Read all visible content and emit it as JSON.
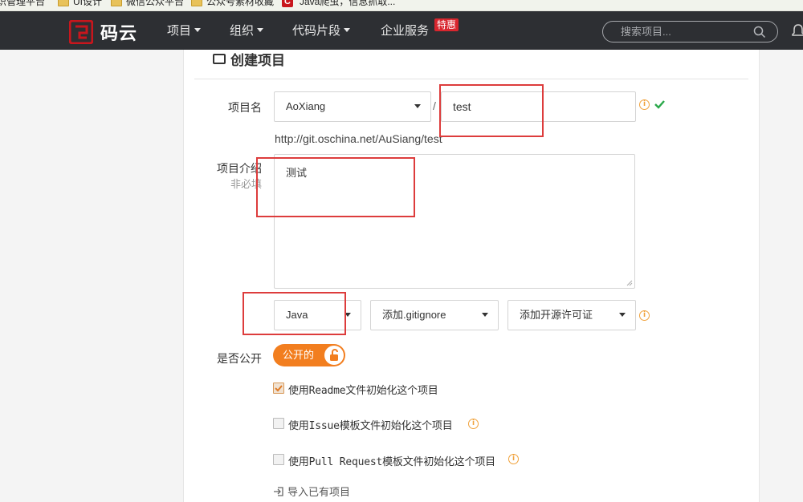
{
  "bookmarks": [
    {
      "label": "识管理平台",
      "type": "text"
    },
    {
      "label": "UI设计",
      "type": "folder"
    },
    {
      "label": "微信公众平台",
      "type": "folder"
    },
    {
      "label": "公众号素材收藏",
      "type": "folder"
    },
    {
      "label": "Java爬虫，信息抓取...",
      "type": "csdn"
    }
  ],
  "navbar": {
    "logo_text": "码云",
    "items": [
      {
        "label": "项目"
      },
      {
        "label": "组织"
      },
      {
        "label": "代码片段"
      },
      {
        "label": "企业服务"
      }
    ],
    "badge": "特惠",
    "search_placeholder": "搜索项目...",
    "colors": {
      "bar": "#2d2f33",
      "logo": "#c8161d",
      "badge": "#d8262e"
    }
  },
  "form": {
    "title": "创建项目",
    "name_label": "项目名",
    "owner": "AoXiang",
    "separator": "/",
    "project_name": "test",
    "url": "http://git.oschina.net/AuSiang/test",
    "desc_label": "项目介绍",
    "desc_sublabel": "非必填",
    "description": "测试",
    "language": "Java",
    "gitignore": "添加.gitignore",
    "license": "添加开源许可证",
    "public_label": "是否公开",
    "public_toggle": "公开的",
    "options": [
      {
        "label": "使用Readme文件初始化这个项目",
        "checked": true,
        "info": false
      },
      {
        "label": "使用Issue模板文件初始化这个项目",
        "checked": false,
        "info": true
      },
      {
        "label": "使用Pull Request模板文件初始化这个项目",
        "checked": false,
        "info": true
      }
    ],
    "import_link": "导入已有项目",
    "colors": {
      "accent": "#f27e1f",
      "info": "#f0a23c",
      "success": "#2aa84a",
      "highlight": "#dd3c3c"
    }
  }
}
